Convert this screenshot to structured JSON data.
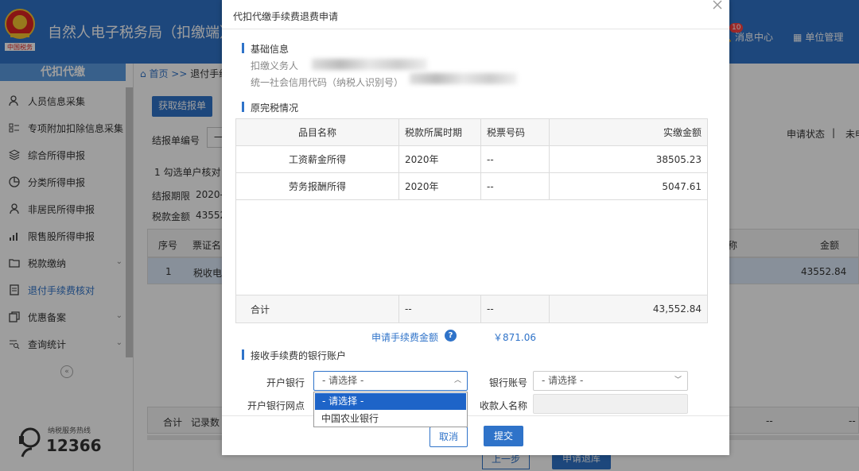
{
  "header": {
    "title": "自然人电子税务局（扣缴端）",
    "messages_label": "消息中心",
    "messages_count": "10",
    "unit_label": "单位管理"
  },
  "sidebar": {
    "heading": "代扣代缴",
    "items": [
      {
        "label": "人员信息采集",
        "icon": "person-icon"
      },
      {
        "label": "专项附加扣除信息采集",
        "icon": "list-icon"
      },
      {
        "label": "综合所得申报",
        "icon": "layers-icon"
      },
      {
        "label": "分类所得申报",
        "icon": "pie-icon"
      },
      {
        "label": "非居民所得申报",
        "icon": "person-outline-icon"
      },
      {
        "label": "限售股所得申报",
        "icon": "bar-chart-icon"
      },
      {
        "label": "税款缴纳",
        "icon": "folder-icon"
      },
      {
        "label": "退付手续费核对",
        "icon": "document-icon"
      },
      {
        "label": "优惠备案",
        "icon": "copy-icon"
      },
      {
        "label": "查询统计",
        "icon": "search-list-icon"
      }
    ],
    "hotline_label": "纳税服务热线",
    "hotline_number": "12366"
  },
  "background": {
    "breadcrumb_home": "首页",
    "breadcrumb_sep": ">>",
    "breadcrumb_current": "退付手续",
    "get_report_button": "获取结报单",
    "report_no_label": "结报单编号",
    "report_no_value": "一",
    "step_text": "1 勾选单户核对",
    "period_label": "结报期限",
    "period_value": "2020-",
    "tax_amount_label": "税款金额",
    "tax_amount_value": "43552",
    "status_label": "申请状态",
    "status_sep": "|",
    "status_value": "未申",
    "table_headers": [
      "序号",
      "票证名",
      "称",
      "金额"
    ],
    "row": {
      "index": "1",
      "name": "税收电",
      "amount": "43552.84"
    },
    "footer": {
      "total": "合计",
      "records": "记录数",
      "dash1": "--",
      "dash2": "--"
    },
    "prev_button": "上一步",
    "apply_button": "申请退库"
  },
  "modal": {
    "title": "代扣代缴手续费退费申请",
    "basic_info_title": "基础信息",
    "withholding_agent_label": "扣缴义务人",
    "credit_code_label": "统一社会信用代码（纳税人识别号）",
    "original_tax_title": "原完税情况",
    "table": {
      "headers": [
        "品目名称",
        "税款所属时期",
        "税票号码",
        "实缴金额"
      ],
      "rows": [
        [
          "工资薪金所得",
          "2020年",
          "--",
          "38505.23"
        ],
        [
          "劳务报酬所得",
          "2020年",
          "--",
          "5047.61"
        ]
      ],
      "total": [
        "合计",
        "--",
        "--",
        "43,552.84"
      ]
    },
    "fee_amount_label": "申请手续费金额",
    "fee_amount_value": "￥871.06",
    "bank_account_title": "接收手续费的银行账户",
    "bank_label": "开户银行",
    "bank_value": "- 请选择 -",
    "account_label": "银行账号",
    "account_value": "- 请选择 -",
    "branch_label": "开户银行网点",
    "payee_label": "收款人名称",
    "bank_options": [
      "- 请选择 -",
      "中国农业银行"
    ],
    "cancel_button": "取消",
    "submit_button": "提交"
  },
  "colors": {
    "primary": "#2f73c9",
    "overlay": "rgba(0,0,0,0.38)"
  }
}
